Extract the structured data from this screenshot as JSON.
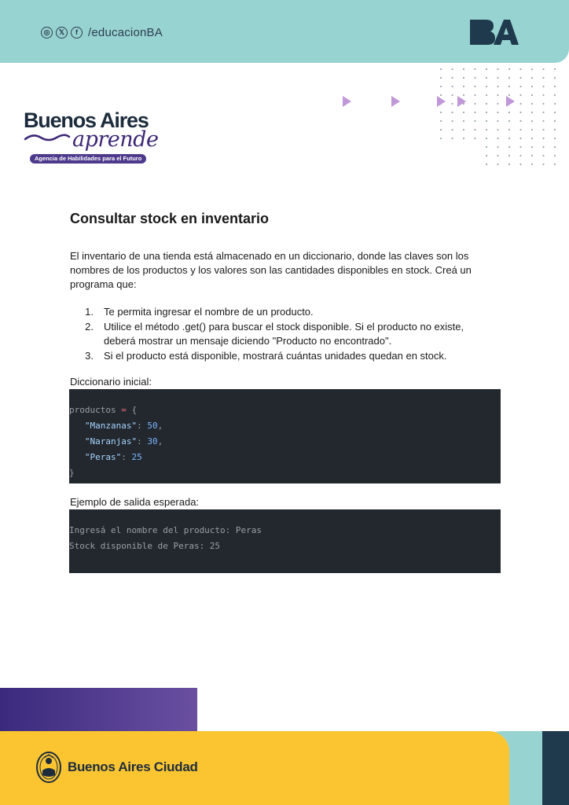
{
  "header": {
    "social_icons": [
      "instagram-icon",
      "x-icon",
      "facebook-icon"
    ],
    "social_glyphs": [
      "◎",
      "𝕏",
      "f"
    ],
    "handle": "/educacionBA",
    "ba_logo": "BA"
  },
  "brand": {
    "title": "Buenos Aires",
    "script": "aprende",
    "tagline": "Agencia de Habilidades para el Futuro"
  },
  "content": {
    "title": "Consultar stock en inventario",
    "intro": "El inventario de una tienda está almacenado en un diccionario, donde las claves son los nombres de los productos y los valores son las cantidades disponibles en stock. Creá un programa que:",
    "steps": [
      {
        "n": "1.",
        "text": "Te permita ingresar el nombre de un producto."
      },
      {
        "n": "2.",
        "text": "Utilice el método .get() para buscar el stock disponible. Si el producto no existe, deberá mostrar un mensaje diciendo \"Producto no encontrado\"."
      },
      {
        "n": "3.",
        "text": "Si el producto está disponible, mostrará cuántas unidades quedan en stock."
      }
    ],
    "dict_label": "Diccionario inicial:",
    "code": {
      "var": "productos",
      "assign": " = ",
      "open": "{",
      "close": "}",
      "entries": [
        {
          "key": "\"Manzanas\"",
          "val": "50",
          "sep": ","
        },
        {
          "key": "\"Naranjas\"",
          "val": "30",
          "sep": ","
        },
        {
          "key": "\"Peras\"",
          "val": "25",
          "sep": ""
        }
      ]
    },
    "output_label": "Ejemplo de salida esperada:",
    "output_lines": [
      "Ingresá el nombre del producto: Peras",
      "Stock disponible de Peras: 25"
    ]
  },
  "footer": {
    "city": "Buenos Aires Ciudad"
  },
  "colors": {
    "header_teal": "#97d3d0",
    "brand_purple": "#4e3a8c",
    "footer_yellow": "#fbc532",
    "navy": "#1e3a4c",
    "code_bg": "#23272e"
  }
}
